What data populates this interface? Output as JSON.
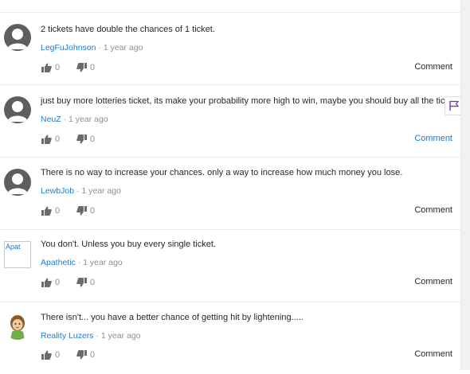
{
  "answers": [
    {
      "text": "2 tickets have double the chances of 1 ticket.",
      "user": "LegFuJohnson",
      "time": "1 year ago",
      "upvotes": "0",
      "downvotes": "0",
      "comment_label": "Comment",
      "avatar": "default-avatar-icon"
    },
    {
      "text": "just buy more lotteries ticket, its make your probability more high to win, maybe you should buy all the ticket",
      "user": "NeuZ",
      "time": "1 year ago",
      "upvotes": "0",
      "downvotes": "0",
      "comment_label": "Comment",
      "avatar": "default-avatar-icon"
    },
    {
      "text": "There is no way to increase your chances. only a way to increase how much money you lose.",
      "user": "LewbJob",
      "time": "1 year ago",
      "upvotes": "0",
      "downvotes": "0",
      "comment_label": "Comment",
      "avatar": "default-avatar-icon"
    },
    {
      "text": "You don't. Unless you buy every single ticket.",
      "user": "Apathetic",
      "time": "1 year ago",
      "upvotes": "0",
      "downvotes": "0",
      "comment_label": "Comment",
      "avatar": "broken-image-icon",
      "avatar_alt": "Apat"
    },
    {
      "text": "There isn't... you have a better chance of getting hit by lightening.....",
      "user": "Reality Luzers",
      "time": "1 year ago",
      "upvotes": "0",
      "downvotes": "0",
      "comment_label": "Comment",
      "avatar": "cartoon-avatar-icon"
    }
  ],
  "meta_separator": "·",
  "colors": {
    "link_blue": "#1e7cd8",
    "muted": "#8f8f8f",
    "flag_purple": "#7b2fbf",
    "avatar_gray": "#5e5e5e"
  },
  "icons": {
    "thumbs_up": "thumbs-up-icon",
    "thumbs_down": "thumbs-down-icon",
    "flag": "flag-icon"
  }
}
